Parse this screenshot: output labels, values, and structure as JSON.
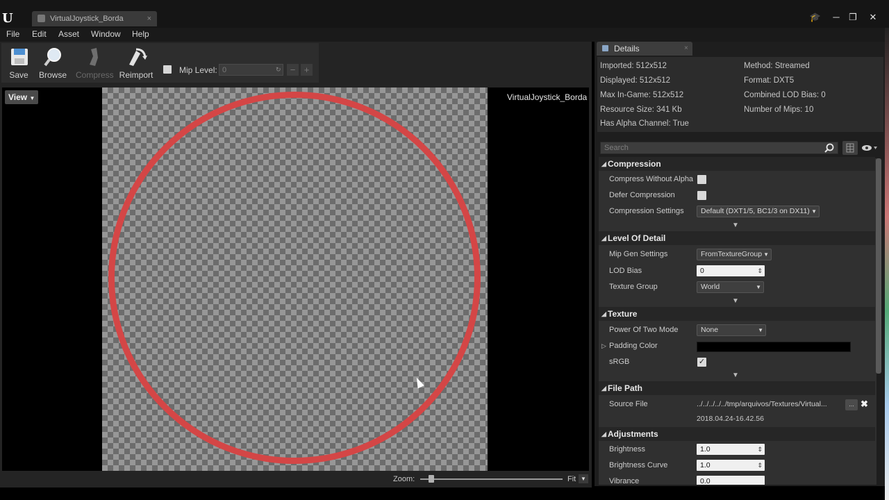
{
  "window": {
    "tab_title": "VirtualJoystick_Borda",
    "tab_close": "×",
    "controls": [
      "🎓",
      "─",
      "❐",
      "✕"
    ]
  },
  "menu": {
    "items": [
      "File",
      "Edit",
      "Asset",
      "Window",
      "Help"
    ]
  },
  "toolbar": {
    "save_label": "Save",
    "browse_label": "Browse",
    "compress_label": "Compress",
    "reimport_label": "Reimport",
    "mip_label": "Mip Level:",
    "mip_value": "0",
    "mip_minus": "−",
    "mip_plus": "+"
  },
  "viewport": {
    "view_button": "View",
    "asset_name": "VirtualJoystick_Borda",
    "zoom_label": "Zoom:",
    "fit_label": "Fit"
  },
  "details": {
    "tab_label": "Details",
    "tab_close": "×",
    "info_left": [
      "Imported: 512x512",
      "Displayed: 512x512",
      "Max In-Game: 512x512",
      "Resource Size: 341 Kb",
      "Has Alpha Channel: True"
    ],
    "info_right": [
      "Method: Streamed",
      "Format: DXT5",
      "Combined LOD Bias: 0",
      "Number of Mips: 10"
    ],
    "search_placeholder": "Search",
    "compression": {
      "title": "Compression",
      "compress_without_alpha": "Compress Without Alpha",
      "defer_compression": "Defer Compression",
      "compression_settings": "Compression Settings",
      "compression_settings_value": "Default (DXT1/5, BC1/3 on DX11)"
    },
    "lod": {
      "title": "Level Of Detail",
      "mip_gen_settings": "Mip Gen Settings",
      "mip_gen_value": "FromTextureGroup",
      "lod_bias": "LOD Bias",
      "lod_bias_value": "0",
      "texture_group": "Texture Group",
      "texture_group_value": "World"
    },
    "texture": {
      "title": "Texture",
      "power_of_two": "Power Of Two Mode",
      "power_of_two_value": "None",
      "padding_color": "Padding Color",
      "srgb": "sRGB",
      "srgb_check": "✓"
    },
    "file_path": {
      "title": "File Path",
      "source_file": "Source File",
      "source_value": "../../../../../tmp/arquivos/Textures/Virtual...",
      "browse_dots": "...",
      "clear": "✖",
      "date": "2018.04.24-16.42.56"
    },
    "adjustments": {
      "title": "Adjustments",
      "brightness": "Brightness",
      "brightness_value": "1.0",
      "brightness_curve": "Brightness Curve",
      "brightness_curve_value": "1.0",
      "vibrance": "Vibrance",
      "vibrance_value": "0.0"
    }
  },
  "colors": {
    "ring": "#d44646",
    "panel": "#303030",
    "category": "#262626"
  }
}
